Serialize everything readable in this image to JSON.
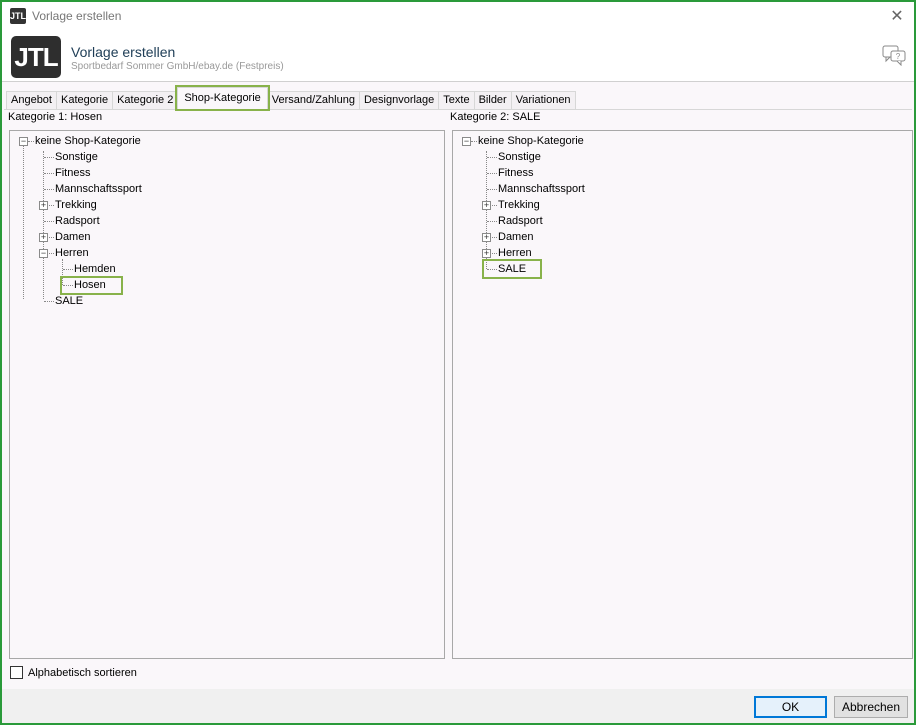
{
  "window": {
    "title": "Vorlage erstellen",
    "badge": "JTL"
  },
  "header": {
    "logo": "JTL",
    "title": "Vorlage erstellen",
    "subtitle": "Sportbedarf Sommer GmbH/ebay.de (Festpreis)"
  },
  "tabs": [
    {
      "label": "Angebot"
    },
    {
      "label": "Kategorie"
    },
    {
      "label": "Kategorie 2"
    },
    {
      "label": "Shop-Kategorie",
      "active": true
    },
    {
      "label": "Versand/Zahlung"
    },
    {
      "label": "Designvorlage"
    },
    {
      "label": "Texte"
    },
    {
      "label": "Bilder"
    },
    {
      "label": "Variationen"
    }
  ],
  "left": {
    "label": "Kategorie 1: Hosen",
    "tree": {
      "root": "keine Shop-Kategorie",
      "items": [
        "Sonstige",
        "Fitness",
        "Mannschaftssport",
        "Trekking",
        "Radsport",
        "Damen",
        "Herren",
        "SALE"
      ],
      "herren_children": [
        "Hemden",
        "Hosen"
      ]
    }
  },
  "right": {
    "label": "Kategorie 2: SALE",
    "tree": {
      "root": "keine Shop-Kategorie",
      "items": [
        "Sonstige",
        "Fitness",
        "Mannschaftssport",
        "Trekking",
        "Radsport",
        "Damen",
        "Herren",
        "SALE"
      ]
    }
  },
  "sort": {
    "label": "Alphabetisch sortieren",
    "checked": false
  },
  "buttons": {
    "ok": "OK",
    "cancel": "Abbrechen"
  },
  "colors": {
    "highlight": "#88b24a",
    "frame": "#2a9a3a",
    "ok_border": "#0078d7"
  }
}
